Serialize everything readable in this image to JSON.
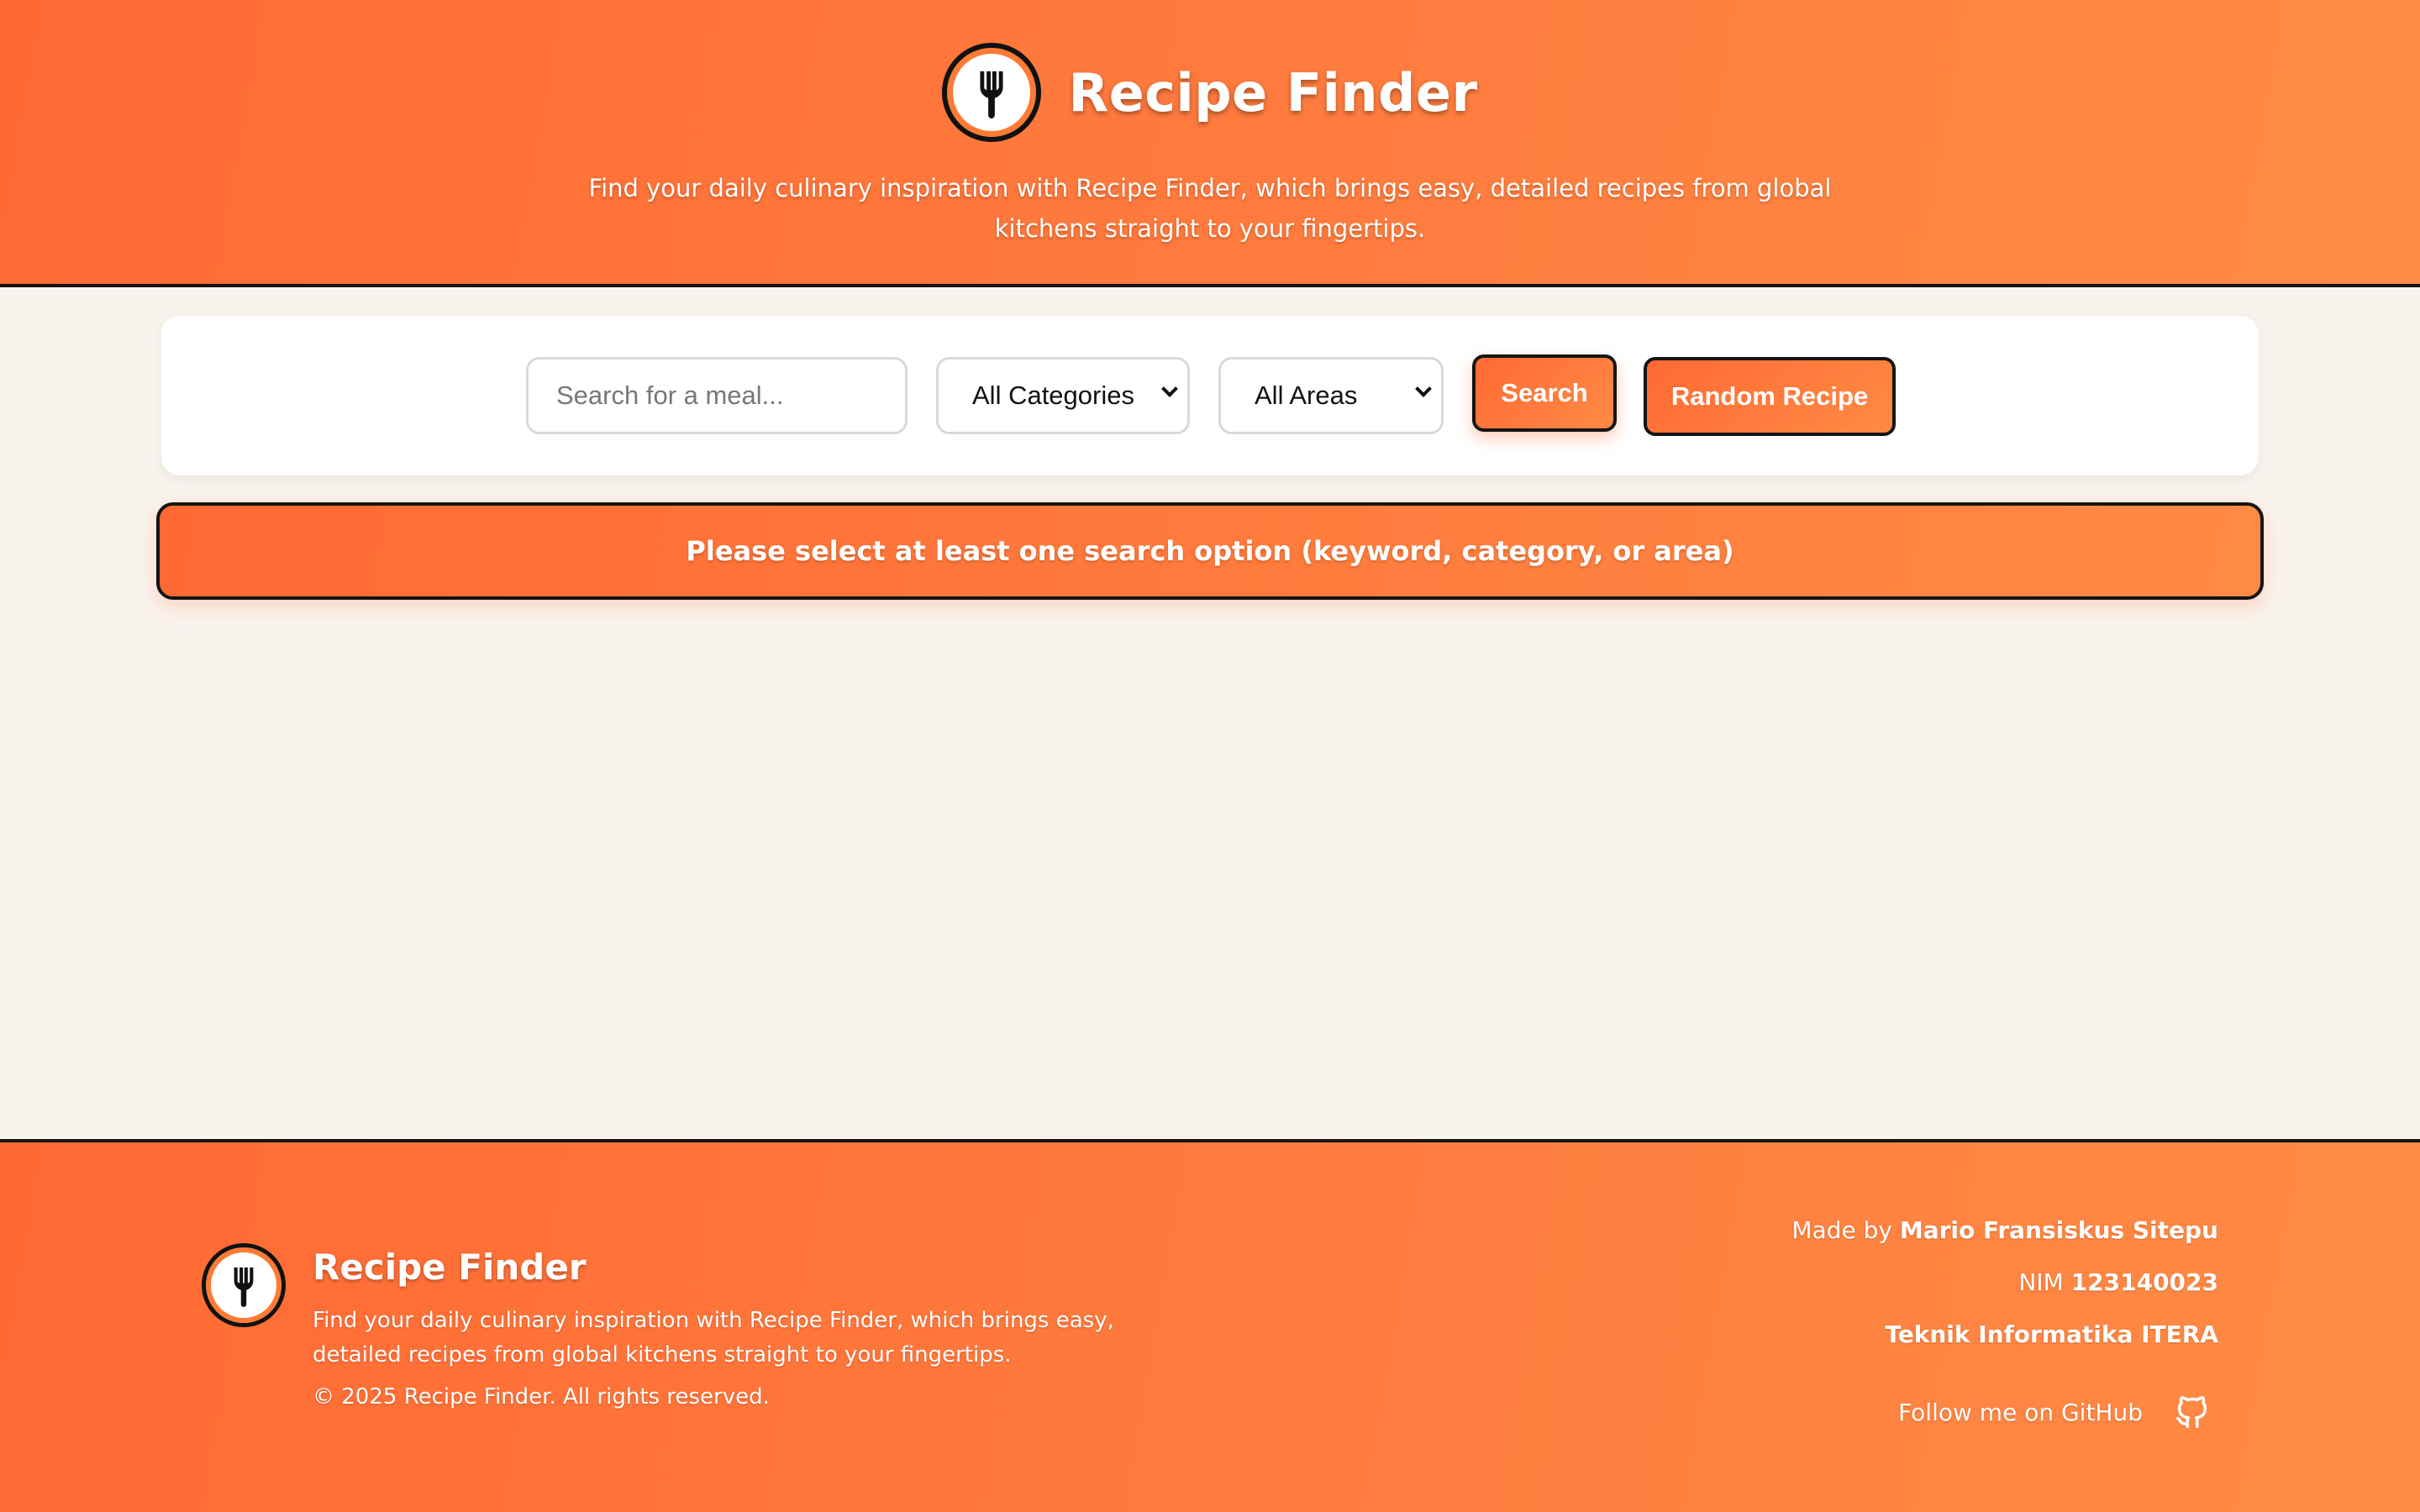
{
  "header": {
    "title": "Recipe Finder",
    "tagline": "Find your daily culinary inspiration with Recipe Finder, which brings easy, detailed recipes from global kitchens straight to your fingertips."
  },
  "search": {
    "placeholder": "Search for a meal...",
    "category_selected": "All Categories",
    "area_selected": "All Areas",
    "search_label": "Search",
    "random_label": "Random Recipe"
  },
  "alert": {
    "message": "Please select at least one search option (keyword, category, or area)"
  },
  "footer": {
    "title": "Recipe Finder",
    "description": "Find your daily culinary inspiration with Recipe Finder, which brings easy, detailed recipes from global kitchens straight to your fingertips.",
    "copyright": "© 2025 Recipe Finder. All rights reserved.",
    "made_by_prefix": "Made by",
    "author": "Mario Fransiskus Sitepu",
    "nim_prefix": "NIM",
    "nim": "123140023",
    "department": "Teknik Informatika ITERA",
    "github_label": "Follow me on GitHub"
  },
  "icons": {
    "logo": "fork-icon",
    "github": "github-icon"
  },
  "colors": {
    "accent_start": "#ff6a33",
    "accent_end": "#ff8c45",
    "background": "#f9f3ee",
    "border": "#141414"
  }
}
